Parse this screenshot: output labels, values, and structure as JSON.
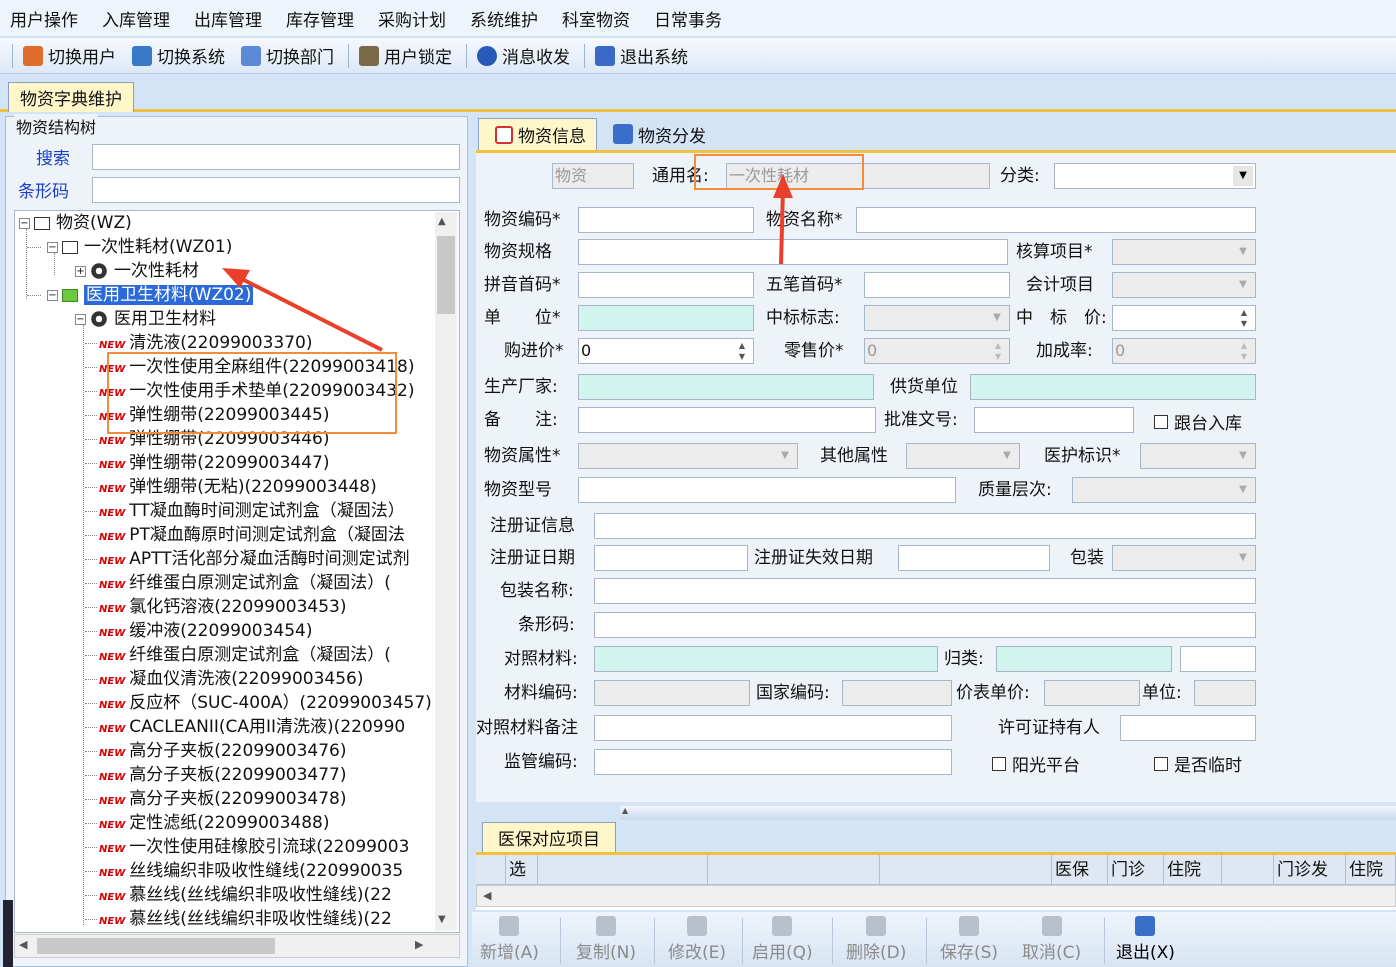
{
  "menu": [
    "用户操作",
    "入库管理",
    "出库管理",
    "库存管理",
    "采购计划",
    "系统维护",
    "科室物资",
    "日常事务"
  ],
  "toolbar": [
    {
      "label": "切换用户",
      "icon": "switch-user-icon",
      "color": "#e06c2c"
    },
    {
      "label": "切换系统",
      "icon": "switch-system-icon",
      "color": "#3a78c8"
    },
    {
      "label": "切换部门",
      "icon": "switch-department-icon",
      "color": "#5a8ad8"
    },
    {
      "label": "用户锁定",
      "icon": "user-lock-icon",
      "color": "#7a6a4a"
    },
    {
      "label": "消息收发",
      "icon": "message-icon",
      "color": "#2a5ab8"
    },
    {
      "label": "退出系统",
      "icon": "exit-system-icon",
      "color": "#3a6ac8"
    }
  ],
  "page_tab": "物资字典维护",
  "left": {
    "group_title": "物资结构树",
    "search_label": "搜索",
    "barcode_label": "条形码",
    "tree": {
      "root": "物资(WZ)",
      "cat1": "一次性耗材(WZ01)",
      "cat1_child": "一次性耗材",
      "cat2": "医用卫生材料(WZ02)",
      "cat2_child": "医用卫生材料",
      "badge": "NEW",
      "items": [
        "清洗液(22099003370)",
        "一次性使用全麻组件(22099003418)",
        "一次性使用手术垫单(22099003432)",
        "弹性绷带(22099003445)",
        "弹性绷带(22099003446)",
        "弹性绷带(22099003447)",
        "弹性绷带(无粘)(22099003448)",
        "TT凝血酶时间测定试剂盒（凝固法）",
        "PT凝血酶原时间测定试剂盒（凝固法",
        "APTT活化部分凝血活酶时间测定试剂",
        "纤维蛋白原测定试剂盒（凝固法）(",
        "氯化钙溶液(22099003453)",
        "缓冲液(22099003454)",
        "纤维蛋白原测定试剂盒（凝固法）(",
        "凝血仪清洗液(22099003456)",
        "反应杯（SUC-400A）(22099003457)",
        "CACLEANII(CA用II清洗液)(220990",
        "高分子夹板(22099003476)",
        "高分子夹板(22099003477)",
        "高分子夹板(22099003478)",
        "定性滤纸(22099003488)",
        "一次性使用硅橡胶引流球(22099003",
        "丝线编织非吸收性缝线(220990035",
        "慕丝线(丝线编织非吸收性缝线)(22",
        "慕丝线(丝线编织非吸收性缝线)(22"
      ]
    }
  },
  "right": {
    "tabs": [
      "物资信息",
      "物资分发"
    ],
    "form": {
      "type_btn": "物资",
      "common_name_label": "通用名:",
      "common_name_value": "一次性耗材",
      "category_label": "分类:",
      "code": "物资编码*",
      "name": "物资名称*",
      "spec": "物资规格",
      "account_item": "核算项目*",
      "pinyin": "拼音首码*",
      "wubi": "五笔首码*",
      "acct_item": "会计项目",
      "unit": "单　　位*",
      "bid_flag": "中标标志:",
      "bid_price": "中　标　价:",
      "purchase_price": "购进价*",
      "purchase_value": "0",
      "retail_price": "零售价*",
      "retail_value": "0",
      "markup": "加成率:",
      "markup_value": "0",
      "manufacturer": "生产厂家:",
      "supplier": "供货单位",
      "remark": "备　　注:",
      "approval": "批准文号:",
      "follow": "跟台入库",
      "attr": "物资属性*",
      "other_attr": "其他属性",
      "medical_flag": "医护标识*",
      "model": "物资型号",
      "quality": "质量层次:",
      "reg_info": "注册证信息",
      "reg_date": "注册证日期",
      "reg_expire": "注册证失效日期",
      "package": "包装",
      "package_name": "包装名称:",
      "barcode": "条形码:",
      "ref_material": "对照材料:",
      "classify": "归类:",
      "material_code": "材料编码:",
      "national_code": "国家编码:",
      "price_table": "价表单价:",
      "price_unit": "单位:",
      "ref_remark": "对照材料备注",
      "license_holder": "许可证持有人",
      "supervise_code": "监管编码:",
      "sunshine": "阳光平台",
      "temporary": "是否临时"
    },
    "bottom_tab": "医保对应项目",
    "grid_headers": [
      "选",
      "医保",
      "门诊",
      "住院",
      "门诊发",
      "住院"
    ]
  },
  "actions": [
    {
      "label": "新增(A)",
      "icon": "add-icon",
      "enabled": false
    },
    {
      "label": "复制(N)",
      "icon": "copy-icon",
      "enabled": false
    },
    {
      "label": "修改(E)",
      "icon": "edit-icon",
      "enabled": false
    },
    {
      "label": "启用(Q)",
      "icon": "enable-icon",
      "enabled": false
    },
    {
      "label": "删除(D)",
      "icon": "delete-icon",
      "enabled": false
    },
    {
      "label": "保存(S)",
      "icon": "save-icon",
      "enabled": false
    },
    {
      "label": "取消(C)",
      "icon": "cancel-icon",
      "enabled": false
    },
    {
      "label": "退出(X)",
      "icon": "exit-icon",
      "enabled": true
    }
  ]
}
